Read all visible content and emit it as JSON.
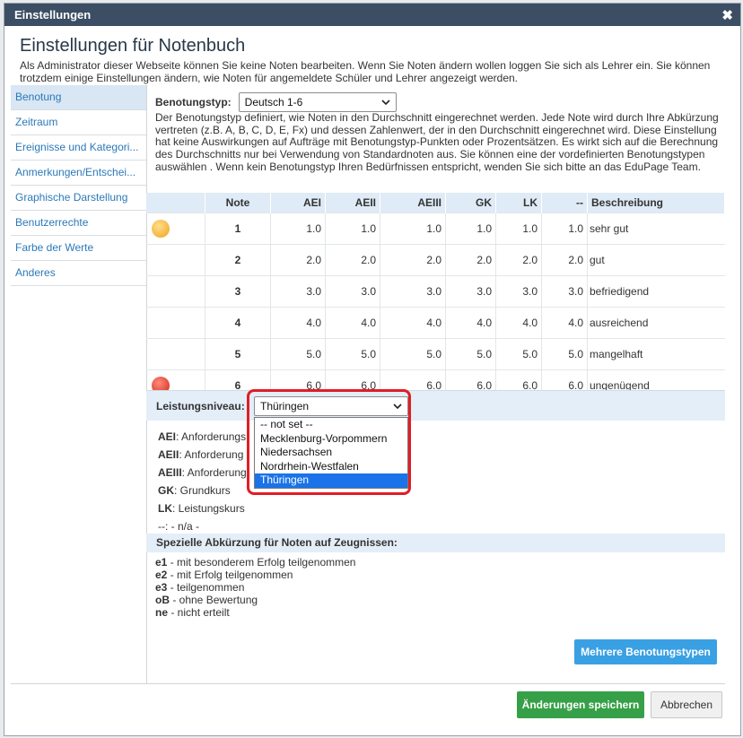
{
  "dialog": {
    "title": "Einstellungen",
    "close": "✖",
    "heading": "Einstellungen für Notenbuch",
    "intro": "Als Administrator dieser Webseite können Sie keine Noten bearbeiten. Wenn Sie Noten ändern wollen loggen Sie sich als Lehrer ein. Sie können trotzdem einige Einstellungen ändern, wie Noten für angemeldete Schüler und Lehrer angezeigt werden."
  },
  "sidebar": {
    "items": [
      {
        "label": "Benotung"
      },
      {
        "label": "Zeitraum"
      },
      {
        "label": "Ereignisse und Kategori..."
      },
      {
        "label": "Anmerkungen/Entschei..."
      },
      {
        "label": "Graphische Darstellung"
      },
      {
        "label": "Benutzerrechte"
      },
      {
        "label": "Farbe der Werte"
      },
      {
        "label": "Anderes"
      }
    ]
  },
  "grading": {
    "type_label": "Benotungstyp:",
    "type_value": "Deutsch 1-6",
    "description": "Der Benotungstyp definiert, wie Noten in den Durchschnitt eingerechnet werden. Jede Note wird durch Ihre Abkürzung vertreten (z.B. A, B, C, D, E, Fx) und dessen Zahlenwert, der in den Durchschnitt eingerechnet wird. Diese Einstellung hat keine Auswirkungen auf Aufträge mit Benotungstyp-Punkten oder Prozentsätzen. Es wirkt sich auf die Berechnung des Durchschnitts nur bei Verwendung von Standardnoten aus. Sie können eine der vordefinierten Benotungstypen auswählen . Wenn kein Benotungstyp Ihren Bedürfnissen entspricht, wenden Sie sich bitte an das EduPage Team."
  },
  "table": {
    "headers": [
      "",
      "Note",
      "AEI",
      "AEII",
      "AEIII",
      "GK",
      "LK",
      "--",
      "Beschreibung"
    ],
    "rows": [
      {
        "icon": "good",
        "note": "1",
        "aei": "1.0",
        "aeii": "1.0",
        "aeiii": "1.0",
        "gk": "1.0",
        "lk": "1.0",
        "dash": "1.0",
        "desc": "sehr gut"
      },
      {
        "icon": "",
        "note": "2",
        "aei": "2.0",
        "aeii": "2.0",
        "aeiii": "2.0",
        "gk": "2.0",
        "lk": "2.0",
        "dash": "2.0",
        "desc": "gut"
      },
      {
        "icon": "",
        "note": "3",
        "aei": "3.0",
        "aeii": "3.0",
        "aeiii": "3.0",
        "gk": "3.0",
        "lk": "3.0",
        "dash": "3.0",
        "desc": "befriedigend"
      },
      {
        "icon": "",
        "note": "4",
        "aei": "4.0",
        "aeii": "4.0",
        "aeiii": "4.0",
        "gk": "4.0",
        "lk": "4.0",
        "dash": "4.0",
        "desc": "ausreichend"
      },
      {
        "icon": "",
        "note": "5",
        "aei": "5.0",
        "aeii": "5.0",
        "aeiii": "5.0",
        "gk": "5.0",
        "lk": "5.0",
        "dash": "5.0",
        "desc": "mangelhaft"
      },
      {
        "icon": "bad",
        "note": "6",
        "aei": "6.0",
        "aeii": "6.0",
        "aeiii": "6.0",
        "gk": "6.0",
        "lk": "6.0",
        "dash": "6.0",
        "desc": "ungenügend"
      }
    ]
  },
  "level": {
    "label": "Leistungsniveau:",
    "value": "Thüringen",
    "options": [
      "-- not set --",
      "Mecklenburg-Vorpommern",
      "Niedersachsen",
      "Nordrhein-Westfalen",
      "Thüringen"
    ]
  },
  "abbreviations": [
    {
      "code": "AEI",
      "text": ": Anforderungs"
    },
    {
      "code": "AEII",
      "text": ": Anforderung"
    },
    {
      "code": "AEIII",
      "text": ": Anforderung"
    },
    {
      "code": "GK",
      "text": ": Grundkurs"
    },
    {
      "code": "LK",
      "text": ": Leistungskurs"
    },
    {
      "code": "--",
      "text": ": - n/a -"
    }
  ],
  "special": {
    "heading": "Spezielle Abkürzung für Noten auf Zeugnissen:",
    "items": [
      {
        "code": "e1",
        "text": " - mit besonderem Erfolg teilgenommen"
      },
      {
        "code": "e2",
        "text": " - mit Erfolg teilgenommen"
      },
      {
        "code": "e3",
        "text": " - teilgenommen"
      },
      {
        "code": "oB",
        "text": " - ohne Bewertung"
      },
      {
        "code": "ne",
        "text": " - nicht erteilt"
      }
    ]
  },
  "buttons": {
    "multiple": "Mehrere Benotungstypen",
    "save": "Änderungen speichern",
    "cancel": "Abbrechen"
  },
  "colors": {
    "titlebar": "#3c4e63",
    "accent": "#3aa0e4",
    "save": "#36a048",
    "highlight": "#e01e26"
  }
}
